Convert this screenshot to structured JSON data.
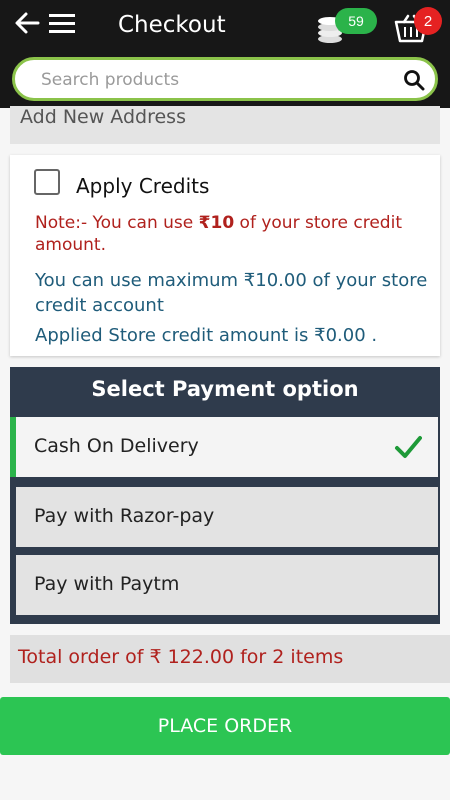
{
  "header": {
    "title": "Checkout",
    "coin_count": "59",
    "cart_count": "2"
  },
  "search": {
    "placeholder": "Search products"
  },
  "address": {
    "label": "Add New Address"
  },
  "credits": {
    "label": "Apply Credits",
    "checked": false,
    "note_prefix": "Note:- You can use ",
    "note_amount": "₹10",
    "note_suffix": " of your store credit amount.",
    "max_text": "You can use maximum ₹10.00 of your store credit account",
    "applied_text": "Applied Store credit amount is ₹0.00 ."
  },
  "payment": {
    "title": "Select Payment option",
    "options": [
      {
        "label": "Cash On Delivery",
        "selected": true
      },
      {
        "label": "Pay with Razor-pay",
        "selected": false
      },
      {
        "label": "Pay with Paytm",
        "selected": false
      }
    ]
  },
  "summary": {
    "total_text": "Total order of ₹ 122.00 for 2 items"
  },
  "actions": {
    "place_order": "PLACE ORDER"
  },
  "colors": {
    "header_bg": "#171717",
    "accent_green": "#2cc553",
    "search_border": "#8bc34a",
    "payment_bg": "#2f3b4c",
    "note_red": "#b0211d",
    "info_blue": "#1f5c7a",
    "coin_badge": "#2bb34a",
    "cart_badge": "#e52222"
  },
  "icons": [
    "back-arrow-icon",
    "hamburger-menu-icon",
    "coins-icon",
    "cart-icon",
    "search-icon",
    "checkmark-icon"
  ]
}
